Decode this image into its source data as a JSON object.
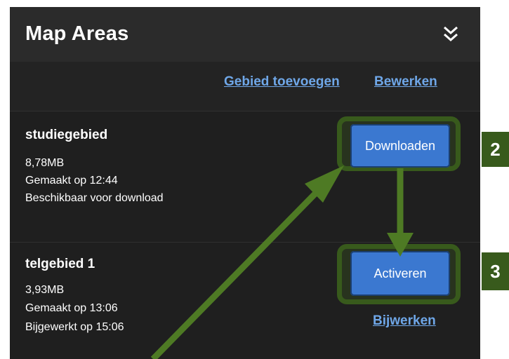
{
  "header": {
    "title": "Map Areas",
    "collapse_icon": "double-chevron-down-icon"
  },
  "actions": {
    "add_area": "Gebied toevoegen",
    "edit": "Bewerken"
  },
  "areas": [
    {
      "name": "studiegebied",
      "size": "8,78MB",
      "created": "Gemaakt op 12:44",
      "status": "Beschikbaar voor download",
      "primary_button": "Downloaden"
    },
    {
      "name": "telgebied 1",
      "size": "3,93MB",
      "created": "Gemaakt op 13:06",
      "updated": "Bijgewerkt op 15:06",
      "primary_button": "Activeren",
      "secondary_link": "Bijwerken"
    }
  ],
  "annotations": {
    "step_download": "2",
    "step_activate": "3",
    "highlight_color": "#385a1c",
    "arrow_color": "#4e7a24"
  },
  "colors": {
    "panel": "#1f1f1f",
    "header": "#2b2b2b",
    "button": "#3b78d0",
    "link": "#6fa7e8"
  }
}
